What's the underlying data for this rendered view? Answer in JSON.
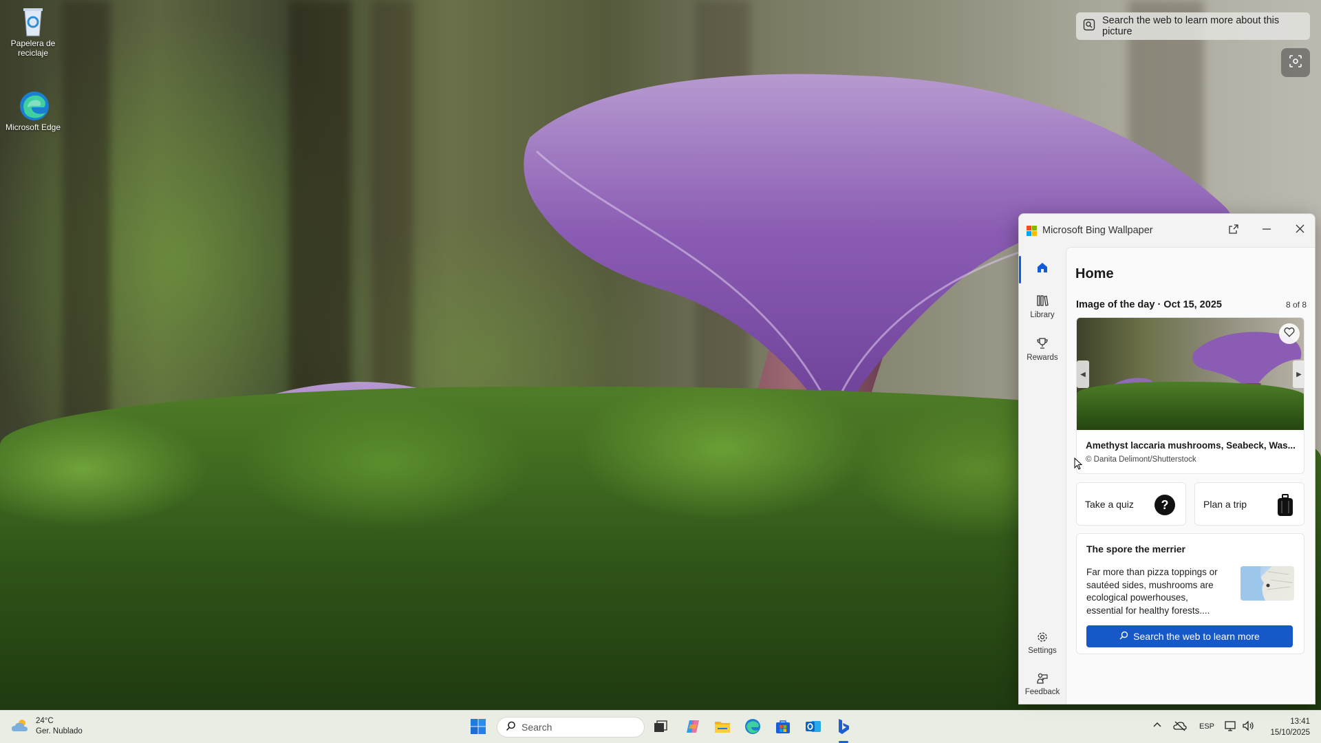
{
  "desktop": {
    "icons": [
      {
        "label": "Papelera de reciclaje",
        "icon": "recycle-bin-icon"
      },
      {
        "label": "Microsoft Edge",
        "icon": "edge-icon"
      }
    ]
  },
  "overlay": {
    "learn_text": "Search the web to learn more about this picture",
    "lens_icon": "visual-search-icon"
  },
  "window": {
    "title": "Microsoft Bing Wallpaper",
    "nav": [
      {
        "label": "",
        "icon": "home-icon",
        "active": true
      },
      {
        "label": "Library",
        "icon": "library-icon"
      },
      {
        "label": "Rewards",
        "icon": "trophy-icon"
      },
      {
        "label": "Settings",
        "icon": "gear-icon"
      },
      {
        "label": "Feedback",
        "icon": "feedback-icon"
      }
    ],
    "home": {
      "title": "Home",
      "image_of_day": "Image of the day · Oct 15, 2025",
      "count": "8 of 8",
      "caption": "Amethyst laccaria mushrooms, Seabeck, Was...",
      "credit": "© Danita Delimont/Shutterstock"
    },
    "actions": [
      {
        "label": "Take a quiz",
        "icon": "question-icon"
      },
      {
        "label": "Plan a trip",
        "icon": "luggage-icon"
      }
    ],
    "article": {
      "title": "The spore the merrier",
      "body": "Far more than pizza toppings or sautéed sides, mushrooms are ecological powerhouses, essential for healthy forests....",
      "button": "Search the web to learn more"
    },
    "colors": {
      "accent": "#1658c8",
      "nav_active": "#0f5bd8"
    }
  },
  "taskbar": {
    "weather": {
      "temp": "24°C",
      "condition": "Ger. Nublado"
    },
    "search_placeholder": "Search",
    "apps": [
      "start-icon",
      "task-view-icon",
      "copilot-icon",
      "file-explorer-icon",
      "edge-icon",
      "store-icon",
      "outlook-icon",
      "bing-icon"
    ],
    "language": "ESP",
    "time": "13:41",
    "date": "15/10/2025"
  }
}
